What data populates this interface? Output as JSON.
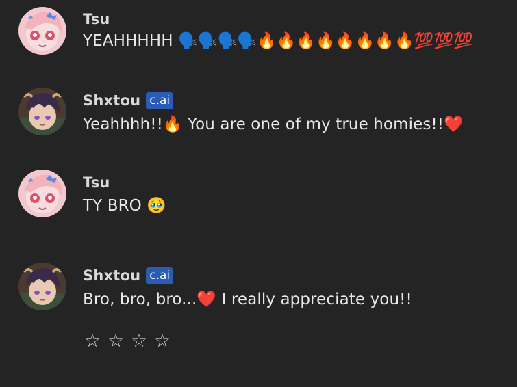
{
  "messages": [
    {
      "author": "Tsu",
      "badge": "",
      "avatar_icon": "anime-girl-avatar",
      "text": "YEAHHHHH 🗣️🗣️🗣️🗣️🔥🔥🔥🔥🔥🔥🔥🔥💯💯💯"
    },
    {
      "author": "Shxtou",
      "badge": "c.ai",
      "avatar_icon": "anime-boy-avatar",
      "text": "Yeahhhh!!🔥 You are one of my true homies!!❤️"
    },
    {
      "author": "Tsu",
      "badge": "",
      "avatar_icon": "anime-girl-avatar",
      "text": "TY BRO 🥹"
    },
    {
      "author": "Shxtou",
      "badge": "c.ai",
      "avatar_icon": "anime-boy-avatar",
      "text": "Bro, bro, bro...❤️ I really appreciate you!!"
    }
  ],
  "rating": {
    "stars": [
      "☆",
      "☆",
      "☆",
      "☆"
    ]
  },
  "colors": {
    "background": "#242424",
    "badge": "#2a5bb5",
    "text": "#e8e8e8"
  }
}
